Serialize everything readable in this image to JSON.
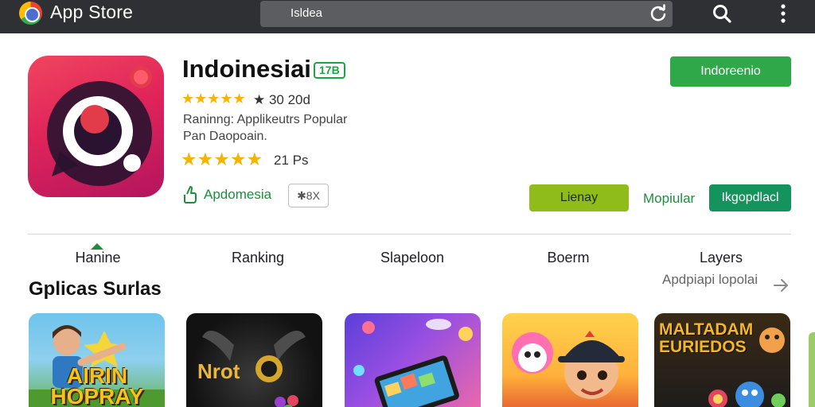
{
  "topbar": {
    "title": "App Store",
    "address_text": "Isldea",
    "icons": [
      "app-store-logo-icon",
      "reload-icon",
      "search-icon",
      "more-vert-icon"
    ]
  },
  "app": {
    "name": "Indoinesiai",
    "age_rating": "17B",
    "rating_line": "★ 30 20d",
    "meta_line1": "Raninng: Applikeutrs Popular",
    "meta_line2": "Pan Daopoain.",
    "rating_count": "21 Ps",
    "developer": "Apdomesia",
    "size_chip": "✱8X",
    "stars_count": 5
  },
  "buttons": {
    "install": "Indoreenio",
    "primary": "Lienay",
    "popular": "Mopiular",
    "secondary": "Ikgopdlacl"
  },
  "tabs": [
    {
      "label": "Hanine"
    },
    {
      "label": "Ranking"
    },
    {
      "label": "Slapeloon"
    },
    {
      "label": "Boerm"
    },
    {
      "label": "Layers"
    }
  ],
  "section": {
    "title": "Gplicas Surlas",
    "see_more": "Apdpiapi lopolai"
  },
  "thumbnails": [
    {
      "caption": "AIRIN HOPRAY"
    },
    {
      "caption": "Nrot"
    },
    {
      "caption": ""
    },
    {
      "caption": ""
    },
    {
      "caption": "MALTADAM EURIEDOS"
    }
  ],
  "colors": {
    "topbar_bg": "#2f3033",
    "accent_green": "#2fa84a",
    "star_yellow": "#f5b400",
    "app_icon_pink": "#e0245a",
    "yellow_green_button": "#8fbc1b",
    "dark_green_button": "#15935c"
  }
}
